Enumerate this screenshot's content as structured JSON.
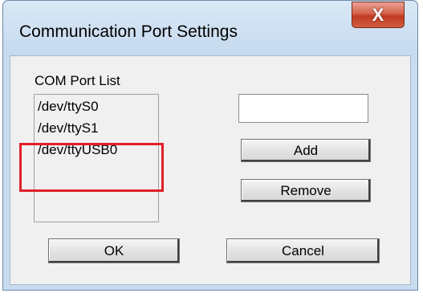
{
  "window": {
    "title": "Communication Port Settings",
    "close_glyph": "X"
  },
  "group": {
    "label": "COM Port List"
  },
  "port_list": {
    "items": [
      "/dev/ttyS0",
      "/dev/ttyS1",
      "/dev/ttyUSB0"
    ]
  },
  "port_input": {
    "value": ""
  },
  "buttons": {
    "add": "Add",
    "remove": "Remove",
    "ok": "OK",
    "cancel": "Cancel"
  },
  "colors": {
    "highlight": "#e0202a",
    "close_button": "#c03a22",
    "frame": "#c9dcef"
  }
}
